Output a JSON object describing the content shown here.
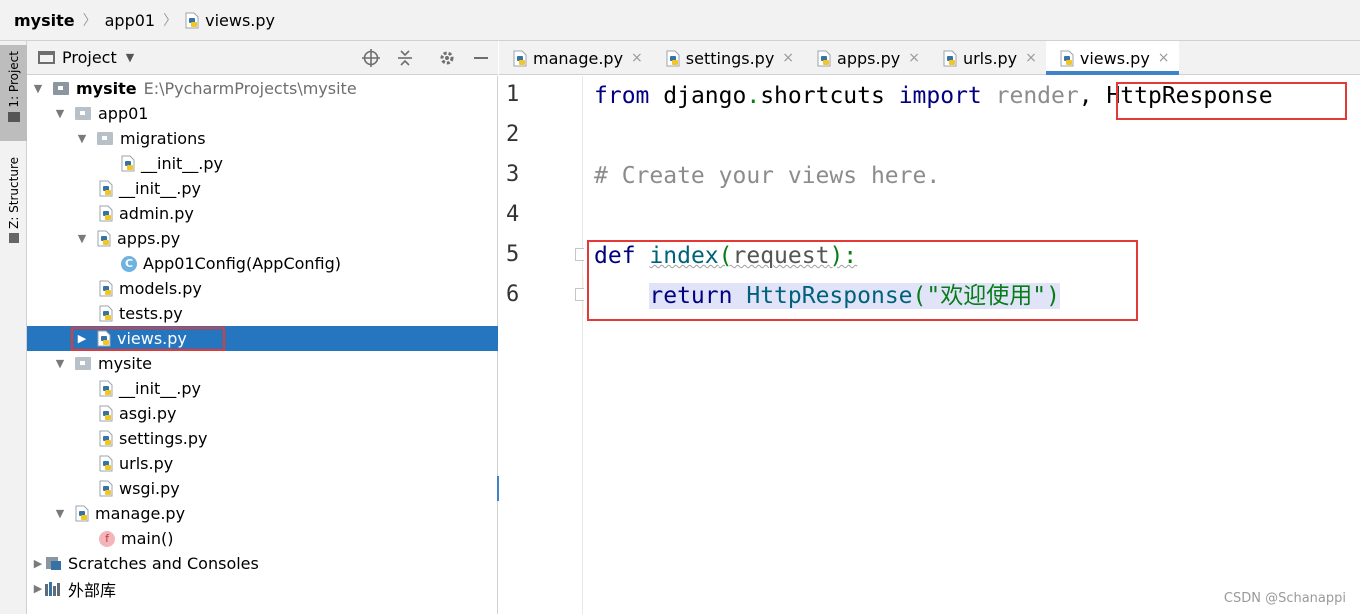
{
  "breadcrumb": {
    "project": "mysite",
    "folder": "app01",
    "file": "views.py"
  },
  "tool_stripe": {
    "project_label": "1: Project",
    "structure_label": "Z: Structure"
  },
  "project_panel": {
    "title": "Project",
    "tree": [
      {
        "label": "mysite",
        "path": "E:\\PycharmProjects\\mysite"
      },
      {
        "label": "app01"
      },
      {
        "label": "migrations"
      },
      {
        "label": "__init__.py"
      },
      {
        "label": "__init__.py"
      },
      {
        "label": "admin.py"
      },
      {
        "label": "apps.py"
      },
      {
        "label": "App01Config(AppConfig)",
        "icon_text": "C"
      },
      {
        "label": "models.py"
      },
      {
        "label": "tests.py"
      },
      {
        "label": "views.py"
      },
      {
        "label": "mysite"
      },
      {
        "label": "__init__.py"
      },
      {
        "label": "asgi.py"
      },
      {
        "label": "settings.py"
      },
      {
        "label": "urls.py"
      },
      {
        "label": "wsgi.py"
      },
      {
        "label": "manage.py"
      },
      {
        "label": "main()",
        "icon_text": "f"
      },
      {
        "label": "Scratches and Consoles"
      },
      {
        "label": "外部库"
      }
    ]
  },
  "tabs": [
    {
      "label": "manage.py",
      "close": "×"
    },
    {
      "label": "settings.py",
      "close": "×"
    },
    {
      "label": "apps.py",
      "close": "×"
    },
    {
      "label": "urls.py",
      "close": "×"
    },
    {
      "label": "views.py",
      "close": "×",
      "active": true
    }
  ],
  "editor": {
    "line_numbers": [
      "1",
      "2",
      "3",
      "4",
      "5",
      "6"
    ],
    "line1": {
      "from": "from",
      "module": "django",
      "dot": ".",
      "sub": "shortcuts",
      "import": "import",
      "render": "render",
      "comma": ", ",
      "cls": "HttpResponse"
    },
    "line3": "# Create your views here.",
    "line5": {
      "def": "def",
      "name": "index",
      "open": "(",
      "param": "request",
      "close": "):"
    },
    "line6": {
      "ret": "return",
      "call": "HttpResponse",
      "open": "(",
      "str": "\"欢迎使用\"",
      "close": ")"
    }
  },
  "watermark": "CSDN @Schanappi",
  "colors": {
    "selection": "#2675bf",
    "annotation_box": "#e53935",
    "tab_underline": "#4083c9",
    "caret_line": "#fcf8e0"
  }
}
